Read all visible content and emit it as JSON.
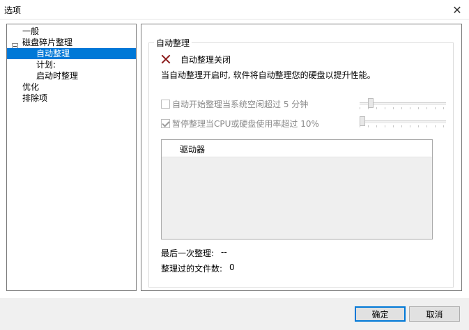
{
  "window": {
    "title": "选项",
    "close_glyph": "✕"
  },
  "tree": {
    "items": [
      {
        "label": "一般",
        "level": 0
      },
      {
        "label": "磁盘碎片整理",
        "level": 0,
        "expanded": true
      },
      {
        "label": "自动整理",
        "level": 1,
        "selected": true
      },
      {
        "label": "计划:",
        "level": 1
      },
      {
        "label": "启动时整理",
        "level": 1
      },
      {
        "label": "优化",
        "level": 0
      },
      {
        "label": "排除项",
        "level": 0
      }
    ]
  },
  "panel": {
    "group_title": "自动整理",
    "status_text": "自动整理关闭",
    "status_icon": "x-icon",
    "description": "当自动整理开启时, 软件将自动整理您的硬盘以提升性能。",
    "option_idle": {
      "label": "自动开始整理当系统空闲超过 5 分钟",
      "checked": false,
      "enabled": false
    },
    "option_pause": {
      "label": "暂停整理当CPU或硬盘使用率超过 10%",
      "checked": true,
      "enabled": false
    },
    "slider_idle": {
      "level": 0.1
    },
    "slider_pause": {
      "level": 0.0
    },
    "drives_column": "驱动器",
    "last_defrag_label": "最后一次整理:",
    "last_defrag_value": "--",
    "files_label": "整理过的文件数:",
    "files_value": "0"
  },
  "footer": {
    "ok_label": "确定",
    "cancel_label": "取消"
  },
  "colors": {
    "selection": "#0078d7",
    "status_icon": "#8b1a1a"
  }
}
